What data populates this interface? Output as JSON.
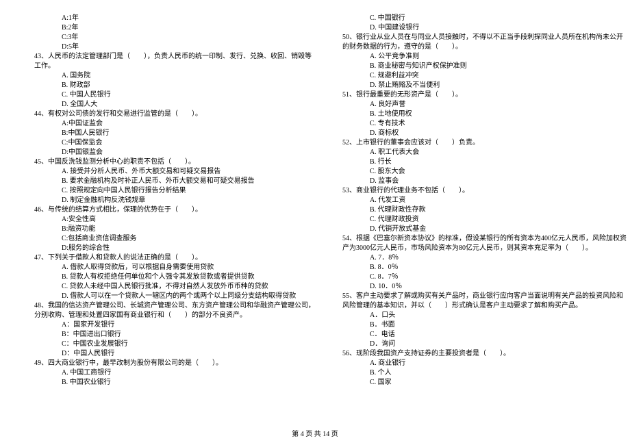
{
  "left": [
    {
      "cls": "indent-option",
      "text": "A:1年"
    },
    {
      "cls": "indent-option",
      "text": "B:2年"
    },
    {
      "cls": "indent-option",
      "text": "C:3年"
    },
    {
      "cls": "indent-option",
      "text": "D:5年"
    },
    {
      "cls": "indent-q",
      "text": "43、人民币的法定管理部门是（　　），负责人民币的统一印制、发行、兑换、收回、销毁等"
    },
    {
      "cls": "indent-q",
      "text": "工作。"
    },
    {
      "cls": "indent-option",
      "text": "A. 国务院"
    },
    {
      "cls": "indent-option",
      "text": "B. 财政部"
    },
    {
      "cls": "indent-option",
      "text": "C. 中国人民银行"
    },
    {
      "cls": "indent-option",
      "text": "D. 全国人大"
    },
    {
      "cls": "indent-q",
      "text": "44、有权对公司债的发行和交易进行监管的是（　　）。"
    },
    {
      "cls": "indent-option",
      "text": "A:中国证监会"
    },
    {
      "cls": "indent-option",
      "text": "B:中国人民银行"
    },
    {
      "cls": "indent-option",
      "text": "C:中国保监会"
    },
    {
      "cls": "indent-option",
      "text": "D:中国银监会"
    },
    {
      "cls": "indent-q",
      "text": "45、中国反洗钱监测分析中心的职责不包括（　　）。"
    },
    {
      "cls": "indent-option",
      "text": "A. 接受并分析人民币、外币大额交易和可疑交易报告"
    },
    {
      "cls": "indent-option",
      "text": "B. 要求金融机构及时补正人民币、外币大额交易和可疑交易报告"
    },
    {
      "cls": "indent-option",
      "text": "C. 按照规定向中国人民银行报告分析结果"
    },
    {
      "cls": "indent-option",
      "text": "D. 制定金融机构反洗钱规章"
    },
    {
      "cls": "indent-q",
      "text": "46、与传统的结算方式相比，保理的优势在于（　　）。"
    },
    {
      "cls": "indent-option",
      "text": "A:安全性高"
    },
    {
      "cls": "indent-option",
      "text": "B:融资功能"
    },
    {
      "cls": "indent-option",
      "text": "C:包括商业资信调查服务"
    },
    {
      "cls": "indent-option",
      "text": "D:服务的综合性"
    },
    {
      "cls": "indent-q",
      "text": "47、下列关于借款人和贷款人的说法正确的是（　　）。"
    },
    {
      "cls": "indent-option",
      "text": "A. 借款人取得贷款后，可以根据自身需要使用贷款"
    },
    {
      "cls": "indent-option",
      "text": "B. 贷款人有权拒绝任何单位和个人强令其发放贷款或者提供贷款"
    },
    {
      "cls": "indent-option",
      "text": "C. 贷款人未经中国人民银行批准，不得对自然人发放外币币种的贷款"
    },
    {
      "cls": "indent-option",
      "text": "D. 借款人可以在一个贷款人一辖区内的两个或两个以上同级分支结构取得贷款"
    },
    {
      "cls": "indent-q",
      "text": "48、我国的信达资产管理公司、长城资产管理公司、东方资产管理公司和华融资产管理公司，"
    },
    {
      "cls": "indent-q",
      "text": "分别收购、管理和处置四家国有商业银行和（　　）的部分不良资产。"
    },
    {
      "cls": "indent-option",
      "text": "A：国家开发银行"
    },
    {
      "cls": "indent-option",
      "text": "B：中国进出口银行"
    },
    {
      "cls": "indent-option",
      "text": "C：中国农业发展银行"
    },
    {
      "cls": "indent-option",
      "text": "D：中国人民银行"
    },
    {
      "cls": "indent-q",
      "text": "49、四大商业银行中，最早改制为股份有限公司的是（　　）。"
    },
    {
      "cls": "indent-option",
      "text": "A. 中国工商银行"
    },
    {
      "cls": "indent-option",
      "text": "B. 中国农业银行"
    }
  ],
  "right": [
    {
      "cls": "indent-option",
      "text": "C. 中国银行"
    },
    {
      "cls": "indent-option",
      "text": "D. 中国建设银行"
    },
    {
      "cls": "indent-q",
      "text": "50、银行业从业人员在与同业人员接触时，不得以不正当手段刺探同业人员所在机构尚未公开"
    },
    {
      "cls": "indent-q",
      "text": "的财务数据的行为，遵守的是（　　）。"
    },
    {
      "cls": "indent-option",
      "text": "A. 公平竞争准则"
    },
    {
      "cls": "indent-option",
      "text": "B. 商业秘密与知识产权保护准则"
    },
    {
      "cls": "indent-option",
      "text": "C. 规避利益冲突"
    },
    {
      "cls": "indent-option",
      "text": "D. 禁止贿赂及不当便利"
    },
    {
      "cls": "indent-q",
      "text": "51、银行最重要的无形资产是（　　）。"
    },
    {
      "cls": "indent-option",
      "text": "A. 良好声誉"
    },
    {
      "cls": "indent-option",
      "text": "B. 土地使用权"
    },
    {
      "cls": "indent-option",
      "text": "C. 专有技术"
    },
    {
      "cls": "indent-option",
      "text": "D. 商标权"
    },
    {
      "cls": "indent-q",
      "text": "52、上市银行的董事会应该对（　　）负责。"
    },
    {
      "cls": "indent-option",
      "text": "A. 职工代表大会"
    },
    {
      "cls": "indent-option",
      "text": "B. 行长"
    },
    {
      "cls": "indent-option",
      "text": "C. 股东大会"
    },
    {
      "cls": "indent-option",
      "text": "D. 监事会"
    },
    {
      "cls": "indent-q",
      "text": "53、商业银行的代理业务不包括（　　）。"
    },
    {
      "cls": "indent-option",
      "text": "A. 代发工资"
    },
    {
      "cls": "indent-option",
      "text": "B. 代理财政性存款"
    },
    {
      "cls": "indent-option",
      "text": "C. 代理财政投资"
    },
    {
      "cls": "indent-option",
      "text": "D. 代销开放式基金"
    },
    {
      "cls": "indent-q",
      "text": "54、根据《巴塞尔新资本协议》的标准，假设某银行的所有资本为400亿元人民币，风险加权资"
    },
    {
      "cls": "indent-q",
      "text": "产为3000亿元人民币，市场风险资本为80亿元人民币，则其资本充足率为（　　）。"
    },
    {
      "cls": "indent-option",
      "text": "A. 7．8％"
    },
    {
      "cls": "indent-option",
      "text": "B. 8．0％"
    },
    {
      "cls": "indent-option",
      "text": "C. 8．7％"
    },
    {
      "cls": "indent-option",
      "text": "D. 10．0％"
    },
    {
      "cls": "indent-q",
      "text": "55、客户主动要求了解或购买有关产品时，商业银行应向客户当面说明有关产品的投资风险和"
    },
    {
      "cls": "indent-q",
      "text": "风险管理的基本知识，并以（　　）形式确认是客户主动要求了解和购买产品。"
    },
    {
      "cls": "indent-option",
      "text": "A．口头"
    },
    {
      "cls": "indent-option",
      "text": "B．书面"
    },
    {
      "cls": "indent-option",
      "text": "C．电话"
    },
    {
      "cls": "indent-option",
      "text": "D．询问"
    },
    {
      "cls": "indent-q",
      "text": "56、现阶段我国资产支持证券的主要投资者是（　　）。"
    },
    {
      "cls": "indent-option",
      "text": "A. 商业银行"
    },
    {
      "cls": "indent-option",
      "text": "B. 个人"
    },
    {
      "cls": "indent-option",
      "text": "C. 国家"
    }
  ],
  "footer": "第 4 页 共 14 页"
}
